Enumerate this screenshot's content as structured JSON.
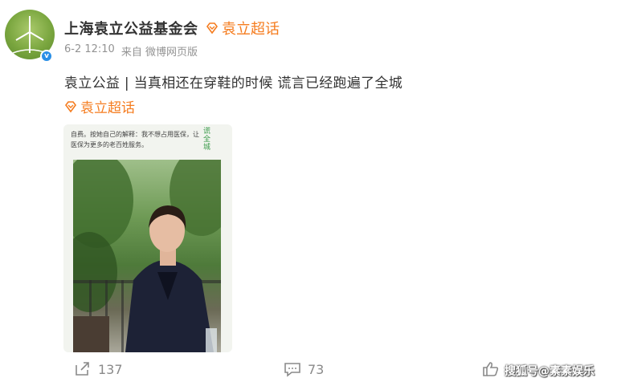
{
  "post": {
    "author": "上海袁立公益基金会",
    "header_topic": "袁立超话",
    "time": "6-2 12:10",
    "source": "来自 微博网页版",
    "text": "袁立公益 | 当真相还在穿鞋的时候 谎言已经跑遍了全城",
    "topic_link": "袁立超话",
    "verified_mark": "v"
  },
  "image": {
    "caption": "自费。按她自己的解释：我不想占用医保，让医保为更多的老百姓服务。",
    "vertical_text": "谎全城"
  },
  "actions": {
    "repost_count": "137",
    "comment_count": "73"
  },
  "watermark": "搜狐号@素素娱乐",
  "colors": {
    "accent": "#f57c1f",
    "text": "#333333",
    "meta": "#939393"
  },
  "icons": [
    "diamond-icon",
    "repost-icon",
    "comment-icon",
    "like-icon"
  ]
}
